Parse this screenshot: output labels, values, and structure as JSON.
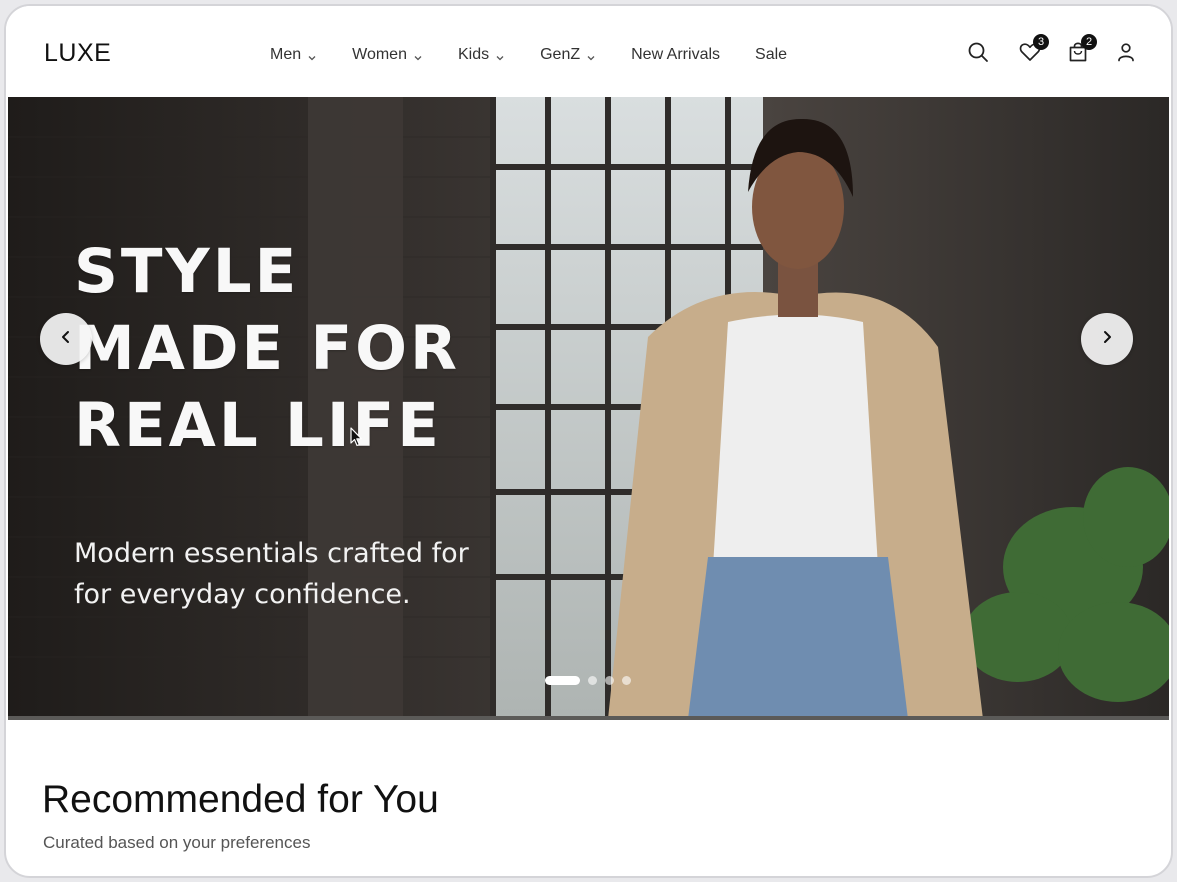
{
  "header": {
    "logo": "LUXE",
    "nav": [
      {
        "label": "Men",
        "dropdown": true
      },
      {
        "label": "Women",
        "dropdown": true
      },
      {
        "label": "Kids",
        "dropdown": true
      },
      {
        "label": "GenZ",
        "dropdown": true
      },
      {
        "label": "New Arrivals",
        "dropdown": false
      },
      {
        "label": "Sale",
        "dropdown": false
      }
    ],
    "wishlist_count": "3",
    "cart_count": "2"
  },
  "hero": {
    "title": "STYLE\nMADE FOR\nREAL LIFE",
    "subtitle": "Modern essentials crafted for\nfor everyday confidence.",
    "slides_total": 4,
    "active_slide": 1
  },
  "recommended": {
    "title": "Recommended for You",
    "subtitle": "Curated based on your preferences"
  },
  "colors": {
    "text": "#111111",
    "badge": "#111111",
    "hero_bg": "#2d2a28"
  }
}
